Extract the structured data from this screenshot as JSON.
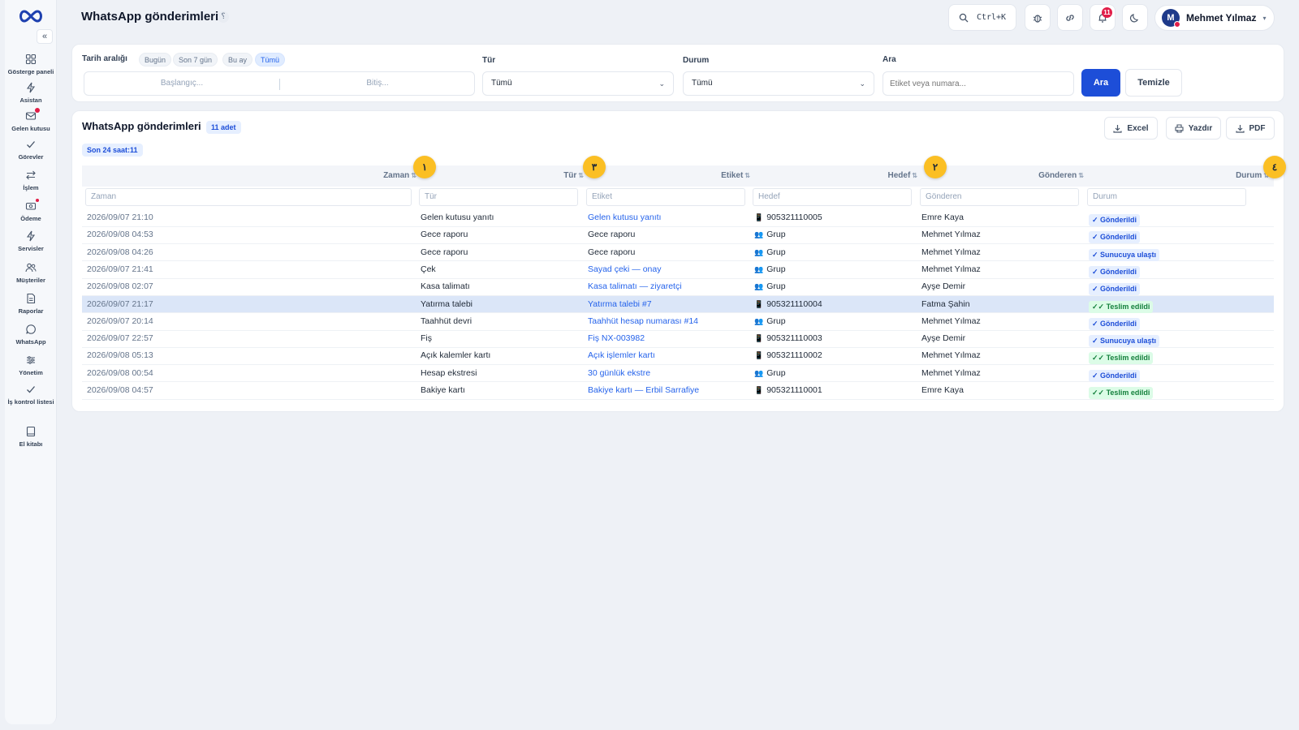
{
  "app": {
    "title": "WhatsApp gönderimleri",
    "title_help": "؟"
  },
  "header": {
    "search_shortcut": "Ctrl+K",
    "notification_count": "11",
    "user": {
      "initial": "M",
      "name": "Mehmet Yılmaz",
      "caret": "▾"
    }
  },
  "sidebar": {
    "collapse": "«",
    "items": [
      {
        "label": "Gösterge paneli",
        "icon": "dashboard-icon"
      },
      {
        "label": "Asistan",
        "icon": "bolt-icon"
      },
      {
        "label": "Gelen kutusu",
        "icon": "inbox-icon"
      },
      {
        "label": "Görevler",
        "icon": "check-icon"
      },
      {
        "label": "İşlem",
        "icon": "transfer-icon"
      },
      {
        "label": "Ödeme",
        "icon": "payment-icon"
      },
      {
        "label": "Servisler",
        "icon": "bolt-icon"
      },
      {
        "label": "Müşteriler",
        "icon": "users-icon"
      },
      {
        "label": "Raporlar",
        "icon": "report-icon"
      },
      {
        "label": "WhatsApp",
        "icon": "chat-icon"
      },
      {
        "label": "Yönetim",
        "icon": "sliders-icon"
      },
      {
        "label": "İş kontrol listesi",
        "icon": "check-icon"
      },
      {
        "label": "El kitabı",
        "icon": "book-icon"
      }
    ]
  },
  "filters": {
    "date_range_label": "Tarih aralığı",
    "presets": [
      "Bugün",
      "Son 7 gün",
      "Bu ay",
      "Tümü"
    ],
    "active_preset": "Tümü",
    "start_placeholder": "Başlangıç...",
    "end_placeholder": "Bitiş...",
    "type_label": "Tür",
    "type_value": "Tümü",
    "status_label": "Durum",
    "status_value": "Tümü",
    "search_label": "Ara",
    "search_placeholder": "Etiket veya numara...",
    "search_button": "Ara",
    "clear_button": "Temizle"
  },
  "table": {
    "title": "WhatsApp gönderimleri",
    "count_badge": "11 adet",
    "last24": "Son 24 saat:11",
    "actions": {
      "excel": "Excel",
      "print": "Yazdır",
      "pdf": "PDF"
    },
    "columns": [
      "Zaman",
      "Tür",
      "Etiket",
      "Hedef",
      "Gönderen",
      "Durum"
    ],
    "sort_glyph": "⇅",
    "filter_placeholders": [
      "Zaman",
      "Tür",
      "Etiket",
      "Hedef",
      "Gönderen",
      "Durum"
    ],
    "markers": [
      "١",
      "٣",
      "٢",
      "٤"
    ],
    "rows": [
      {
        "time": "2026/09/07 21:10",
        "type": "Gelen kutusu yanıtı",
        "label": "Gelen kutusu yanıtı",
        "label_link": true,
        "target_icon": "phone",
        "target": "905321110005",
        "sender": "Emre Kaya",
        "status": "✓ Gönderildi",
        "status_kind": "sent"
      },
      {
        "time": "2026/09/08 04:53",
        "type": "Gece raporu",
        "label": "Gece raporu",
        "label_link": false,
        "target_icon": "group",
        "target": "Grup",
        "sender": "Mehmet Yılmaz",
        "status": "✓ Gönderildi",
        "status_kind": "sent"
      },
      {
        "time": "2026/09/08 04:26",
        "type": "Gece raporu",
        "label": "Gece raporu",
        "label_link": false,
        "target_icon": "group",
        "target": "Grup",
        "sender": "Mehmet Yılmaz",
        "status": "✓ Sunucuya ulaştı",
        "status_kind": "server"
      },
      {
        "time": "2026/09/07 21:41",
        "type": "Çek",
        "label": "Sayad çeki — onay",
        "label_link": true,
        "target_icon": "group",
        "target": "Grup",
        "sender": "Mehmet Yılmaz",
        "status": "✓ Gönderildi",
        "status_kind": "sent"
      },
      {
        "time": "2026/09/08 02:07",
        "type": "Kasa talimatı",
        "label": "Kasa talimatı — ziyaretçi",
        "label_link": true,
        "target_icon": "group",
        "target": "Grup",
        "sender": "Ayşe Demir",
        "status": "✓ Gönderildi",
        "status_kind": "sent"
      },
      {
        "time": "2026/09/07 21:17",
        "type": "Yatırma talebi",
        "label": "Yatırma talebi #7",
        "label_link": true,
        "target_icon": "phone",
        "target": "905321110004",
        "sender": "Fatma Şahin",
        "status": "✓✓ Teslim edildi",
        "status_kind": "delivered",
        "selected": true
      },
      {
        "time": "2026/09/07 20:14",
        "type": "Taahhüt devri",
        "label": "Taahhüt hesap numarası #14",
        "label_link": true,
        "target_icon": "group",
        "target": "Grup",
        "sender": "Mehmet Yılmaz",
        "status": "✓ Gönderildi",
        "status_kind": "sent"
      },
      {
        "time": "2026/09/07 22:57",
        "type": "Fiş",
        "label": "Fiş NX-003982",
        "label_link": true,
        "target_icon": "phone",
        "target": "905321110003",
        "sender": "Ayşe Demir",
        "status": "✓ Sunucuya ulaştı",
        "status_kind": "server"
      },
      {
        "time": "2026/09/08 05:13",
        "type": "Açık kalemler kartı",
        "label": "Açık işlemler kartı",
        "label_link": true,
        "target_icon": "phone",
        "target": "905321110002",
        "sender": "Mehmet Yılmaz",
        "status": "✓✓ Teslim edildi",
        "status_kind": "delivered"
      },
      {
        "time": "2026/09/08 00:54",
        "type": "Hesap ekstresi",
        "label": "30 günlük ekstre",
        "label_link": true,
        "target_icon": "group",
        "target": "Grup",
        "sender": "Mehmet Yılmaz",
        "status": "✓ Gönderildi",
        "status_kind": "sent"
      },
      {
        "time": "2026/09/08 04:57",
        "type": "Bakiye kartı",
        "label": "Bakiye kartı — Erbil Sarrafiye",
        "label_link": true,
        "target_icon": "phone",
        "target": "905321110001",
        "sender": "Emre Kaya",
        "status": "✓✓ Teslim edildi",
        "status_kind": "delivered"
      }
    ]
  },
  "colors": {
    "primary": "#1d4ed8",
    "link": "#2563eb",
    "delivered": "#15803d",
    "selected_row": "#dbe6f8",
    "marker": "#fbbf24"
  }
}
